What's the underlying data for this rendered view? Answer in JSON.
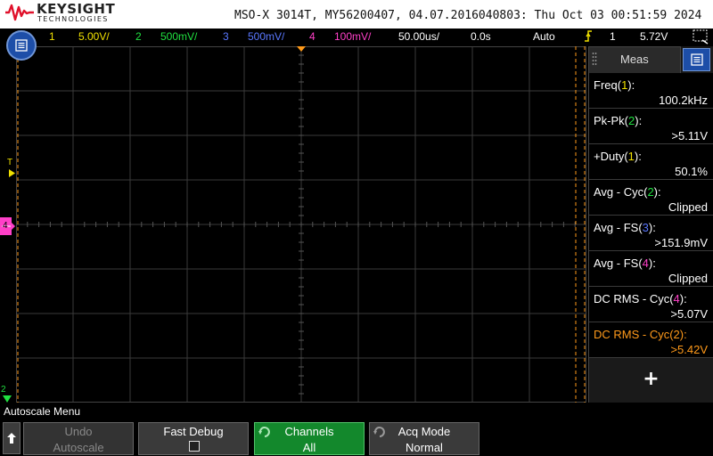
{
  "header": {
    "brand_name": "KEYSIGHT",
    "brand_sub": "TECHNOLOGIES",
    "device_info": "MSO-X 3014T, MY56200407, 04.07.2016040803: Thu Oct 03 00:51:59 2024"
  },
  "topbar": {
    "ch1_num": "1",
    "ch1_scale": "5.00V/",
    "ch2_num": "2",
    "ch2_scale": "500mV/",
    "ch3_num": "3",
    "ch3_scale": "500mV/",
    "ch4_num": "4",
    "ch4_scale": "100mV/",
    "timebase": "50.00us/",
    "delay": "0.0s",
    "trigger_mode": "Auto",
    "trigger_source": "1",
    "trigger_level": "5.72V"
  },
  "scope": {
    "trigger_label": "T",
    "ch4_label": "4",
    "ch2_label": "2"
  },
  "meas_panel": {
    "tab_label": "Meas",
    "add_label": "+",
    "items": [
      {
        "name_pre": "Freq(",
        "ch": "1",
        "name_post": "):",
        "value": "100.2kHz",
        "ch_color": "#f0e000"
      },
      {
        "name_pre": "Pk-Pk(",
        "ch": "2",
        "name_post": "):",
        "value": ">5.11V",
        "ch_color": "#20e040"
      },
      {
        "name_pre": "+Duty(",
        "ch": "1",
        "name_post": "):",
        "value": "50.1%",
        "ch_color": "#f0e000"
      },
      {
        "name_pre": "Avg - Cyc(",
        "ch": "2",
        "name_post": "):",
        "value": "Clipped",
        "ch_color": "#20e040"
      },
      {
        "name_pre": "Avg - FS(",
        "ch": "3",
        "name_post": "):",
        "value": ">151.9mV",
        "ch_color": "#5a78ff"
      },
      {
        "name_pre": "Avg - FS(",
        "ch": "4",
        "name_post": "):",
        "value": "Clipped",
        "ch_color": "#ff40c8"
      },
      {
        "name_pre": "DC RMS - Cyc(",
        "ch": "4",
        "name_post": "):",
        "value": ">5.07V",
        "ch_color": "#ff40c8"
      },
      {
        "name_pre": "DC RMS - Cyc(",
        "ch": "2",
        "name_post": "):",
        "value": ">5.42V",
        "ch_color": "#ff9a1a"
      }
    ]
  },
  "softkeys": {
    "menu_title": "Autoscale Menu",
    "undo_label": "Undo",
    "undo_value": "Autoscale",
    "fast_debug_label": "Fast Debug",
    "channels_label": "Channels",
    "channels_value": "All",
    "acq_mode_label": "Acq Mode",
    "acq_mode_value": "Normal"
  },
  "colors": {
    "ch1": "#f0e000",
    "ch2": "#20e040",
    "ch3": "#5a78ff",
    "ch4": "#ff40c8",
    "active_softkey": "#13882c",
    "accent_blue": "#1d4ea8"
  }
}
